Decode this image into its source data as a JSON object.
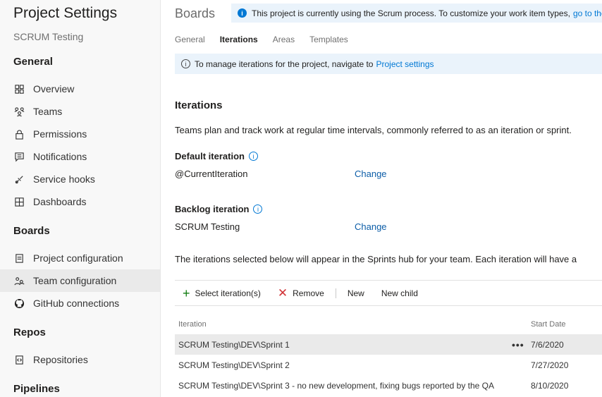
{
  "sidebar": {
    "title": "Project Settings",
    "subtitle": "SCRUM Testing",
    "sections": {
      "general": "General",
      "boards": "Boards",
      "repos": "Repos",
      "pipelines": "Pipelines"
    },
    "items": {
      "overview": {
        "label": "Overview",
        "icon": "overview-icon"
      },
      "teams": {
        "label": "Teams",
        "icon": "teams-icon"
      },
      "permissions": {
        "label": "Permissions",
        "icon": "lock-icon"
      },
      "notifications": {
        "label": "Notifications",
        "icon": "chat-icon"
      },
      "service_hooks": {
        "label": "Service hooks",
        "icon": "hook-icon"
      },
      "dashboards": {
        "label": "Dashboards",
        "icon": "grid-icon"
      },
      "project_configuration": {
        "label": "Project configuration",
        "icon": "doc-icon"
      },
      "team_configuration": {
        "label": "Team configuration",
        "icon": "team-config-icon"
      },
      "github_connections": {
        "label": "GitHub connections",
        "icon": "github-icon"
      },
      "repositories": {
        "label": "Repositories",
        "icon": "repo-icon"
      }
    }
  },
  "header": {
    "title": "Boards",
    "banner_text": "This project is currently using the Scrum process. To customize your work item types,",
    "banner_link": "go to the"
  },
  "tabs": [
    "General",
    "Iterations",
    "Areas",
    "Templates"
  ],
  "notice": {
    "text": "To manage iterations for the project, navigate to",
    "link": "Project settings"
  },
  "iterations": {
    "heading": "Iterations",
    "description": "Teams plan and track work at regular time intervals, commonly referred to as an iteration or sprint.",
    "default_label": "Default iteration",
    "default_value": "@CurrentIteration",
    "backlog_label": "Backlog iteration",
    "backlog_value": "SCRUM Testing",
    "change_label": "Change",
    "sprints_note": "The iterations selected below will appear in the Sprints hub for your team. Each iteration will have a"
  },
  "toolbar": {
    "select": "Select iteration(s)",
    "remove": "Remove",
    "new": "New",
    "new_child": "New child"
  },
  "table": {
    "columns": [
      "Iteration",
      "Start Date"
    ],
    "rows": [
      {
        "iteration": "SCRUM Testing\\DEV\\Sprint 1",
        "start": "7/6/2020"
      },
      {
        "iteration": "SCRUM Testing\\DEV\\Sprint 2",
        "start": "7/27/2020"
      },
      {
        "iteration": "SCRUM Testing\\DEV\\Sprint 3 - no new development, fixing bugs reported by the QA",
        "start": "8/10/2020"
      }
    ],
    "more": "•••"
  },
  "colors": {
    "accent": "#0078d4",
    "add": "#107c10",
    "remove": "#d13438"
  }
}
